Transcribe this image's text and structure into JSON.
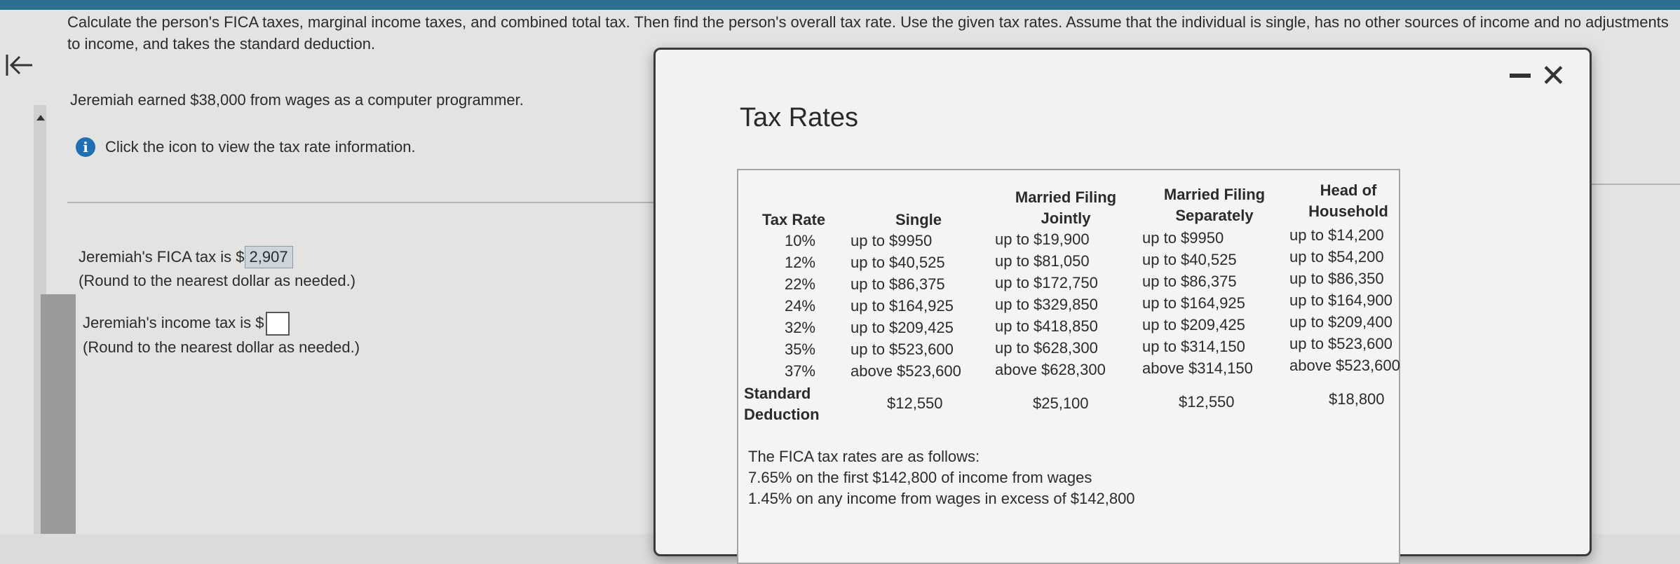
{
  "question": {
    "text": "Calculate the person's FICA taxes, marginal income taxes, and combined total tax. Then find the person's overall tax rate. Use the given tax rates. Assume that the individual is single, has no other sources of income and no adjustments to income, and takes the standard deduction.",
    "scenario": "Jeremiah earned $38,000 from wages as a computer programmer.",
    "info_text": "Click the icon to view the tax rate information."
  },
  "answers": {
    "fica_label": "Jeremiah's FICA tax is $",
    "fica_value": "2,907",
    "fica_note": "(Round to the nearest dollar as needed.)",
    "income_label": "Jeremiah's income tax is $",
    "income_value": "",
    "income_note": "(Round to the nearest dollar as needed.)"
  },
  "modal": {
    "title": "Tax Rates",
    "minimize_label": "-",
    "close_label": "✕",
    "headers": {
      "rate": "Tax Rate",
      "single": "Single",
      "mfj": "Married Filing Jointly",
      "mfs": "Married Filing Separately",
      "hoh": "Head of Household"
    },
    "rows": [
      {
        "rate": "10%",
        "single": "up to $9950",
        "mfj": "up to $19,900",
        "mfs": "up to $9950",
        "hoh": "up to $14,200"
      },
      {
        "rate": "12%",
        "single": "up to $40,525",
        "mfj": "up to $81,050",
        "mfs": "up to $40,525",
        "hoh": "up to $54,200"
      },
      {
        "rate": "22%",
        "single": "up to $86,375",
        "mfj": "up to $172,750",
        "mfs": "up to $86,375",
        "hoh": "up to $86,350"
      },
      {
        "rate": "24%",
        "single": "up to $164,925",
        "mfj": "up to $329,850",
        "mfs": "up to $164,925",
        "hoh": "up to $164,900"
      },
      {
        "rate": "32%",
        "single": "up to $209,425",
        "mfj": "up to $418,850",
        "mfs": "up to $209,425",
        "hoh": "up to $209,400"
      },
      {
        "rate": "35%",
        "single": "up to $523,600",
        "mfj": "up to $628,300",
        "mfs": "up to $314,150",
        "hoh": "up to $523,600"
      },
      {
        "rate": "37%",
        "single": "above $523,600",
        "mfj": "above $628,300",
        "mfs": "above $314,150",
        "hoh": "above $523,600"
      }
    ],
    "standard_deduction": {
      "label": "Standard Deduction",
      "single": "$12,550",
      "mfj": "$25,100",
      "mfs": "$12,550",
      "hoh": "$18,800"
    },
    "fica": {
      "intro": "The FICA tax rates are as follows:",
      "line1": "7.65% on the first $142,800 of income from wages",
      "line2": "1.45% on any income from wages in excess of $142,800"
    }
  },
  "icons": [
    "back-arrow-icon",
    "info-icon",
    "minimize-icon",
    "close-icon",
    "scroll-up-arrow-icon"
  ]
}
